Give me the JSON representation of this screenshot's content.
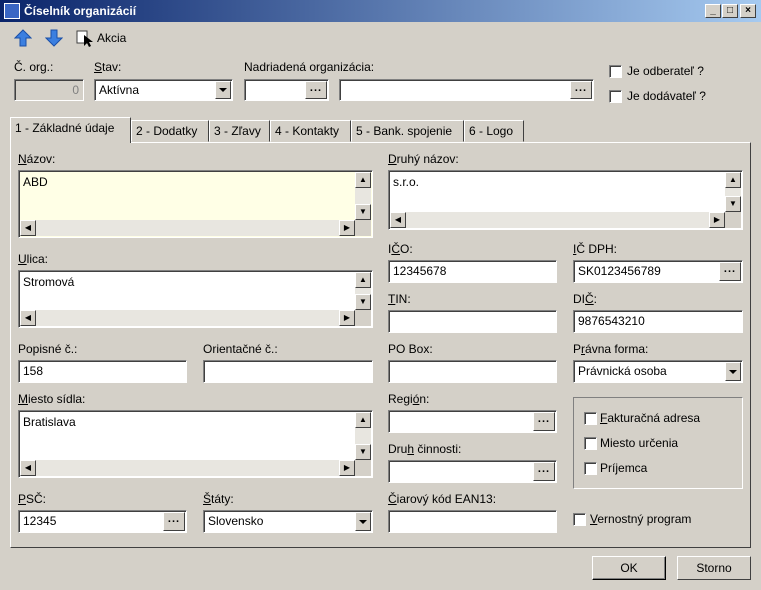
{
  "window": {
    "title": "Číselník organizácií"
  },
  "toolbar": {
    "up": "move-up",
    "down": "move-down",
    "akcia_label": "Akcia"
  },
  "header": {
    "corg_label": "Č. org.:",
    "corg_value": "0",
    "stav_label": "Stav:",
    "stav_value": "Aktívna",
    "nadriadena_label": "Nadriadená organizácia:",
    "odberatel_label": "Je odberateľ ?",
    "dodavatel_label": "Je dodávateľ ?"
  },
  "tabs": [
    {
      "label": "1 - Základné údaje"
    },
    {
      "label": "2 - Dodatky"
    },
    {
      "label": "3 - Zľavy"
    },
    {
      "label": "4 - Kontakty"
    },
    {
      "label": "5 - Bank. spojenie"
    },
    {
      "label": "6 - Logo"
    }
  ],
  "form": {
    "nazov_label": "Názov:",
    "nazov_value": "ABD",
    "druhy_nazov_label": "Druhý názov:",
    "druhy_nazov_value": "s.r.o.",
    "ico_label": "IČO:",
    "ico_value": "12345678",
    "icdph_label": "IČ DPH:",
    "icdph_value": "SK0123456789",
    "ulica_label": "Ulica:",
    "ulica_value": "Stromová",
    "tin_label": "TIN:",
    "tin_value": "",
    "dic_label": "DIČ:",
    "dic_value": "9876543210",
    "popisne_label": "Popisné č.:",
    "popisne_value": "158",
    "orientacne_label": "Orientačné č.:",
    "orientacne_value": "",
    "pobox_label": "PO Box:",
    "pobox_value": "",
    "pravna_label": "Právna forma:",
    "pravna_value": "Právnická osoba",
    "miesto_label": "Miesto sídla:",
    "miesto_value": "Bratislava",
    "region_label": "Región:",
    "region_value": "",
    "druh_label": "Druh činnosti:",
    "druh_value": "",
    "psc_label": "PSČ:",
    "psc_value": "12345",
    "staty_label": "Štáty:",
    "staty_value": "Slovensko",
    "ciarovy_label": "Čiarový kód EAN13:",
    "ciarovy_value": "",
    "fakturacna_label": "Fakturačná adresa",
    "miesto_urcenia_label": "Miesto určenia",
    "prijemca_label": "Príjemca",
    "vernostny_label": "Vernostný program"
  },
  "footer": {
    "ok_label": "OK",
    "storno_label": "Storno"
  }
}
